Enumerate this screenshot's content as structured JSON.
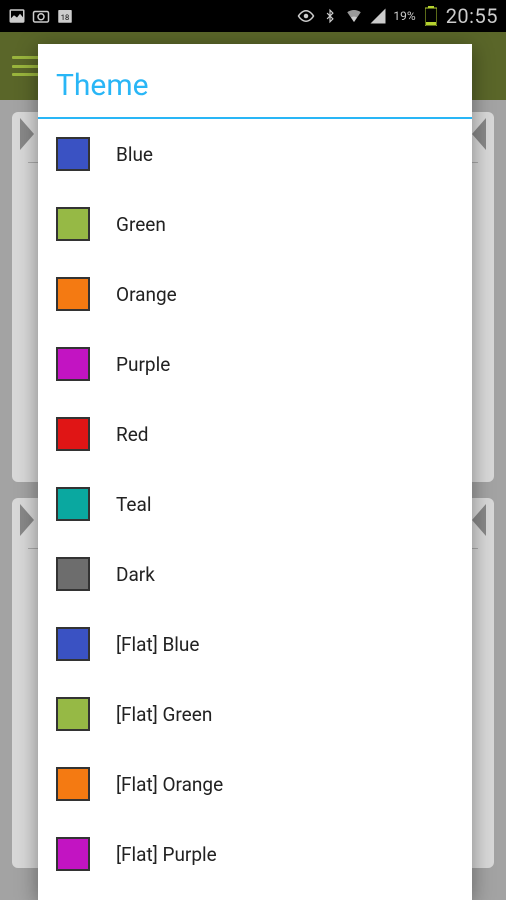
{
  "status": {
    "battery_pct": "19%",
    "clock": "20:55"
  },
  "dialog": {
    "title": "Theme",
    "items": [
      {
        "label": "Blue",
        "color": "#3a52c3"
      },
      {
        "label": "Green",
        "color": "#96b945"
      },
      {
        "label": "Orange",
        "color": "#f47a12"
      },
      {
        "label": "Purple",
        "color": "#c214c2"
      },
      {
        "label": "Red",
        "color": "#e01515"
      },
      {
        "label": "Teal",
        "color": "#0aa8a0"
      },
      {
        "label": "Dark",
        "color": "#6d6d6d"
      },
      {
        "label": "[Flat] Blue",
        "color": "#3a52c3"
      },
      {
        "label": "[Flat] Green",
        "color": "#96b945"
      },
      {
        "label": "[Flat] Orange",
        "color": "#f47a12"
      },
      {
        "label": "[Flat] Purple",
        "color": "#c214c2"
      }
    ]
  }
}
